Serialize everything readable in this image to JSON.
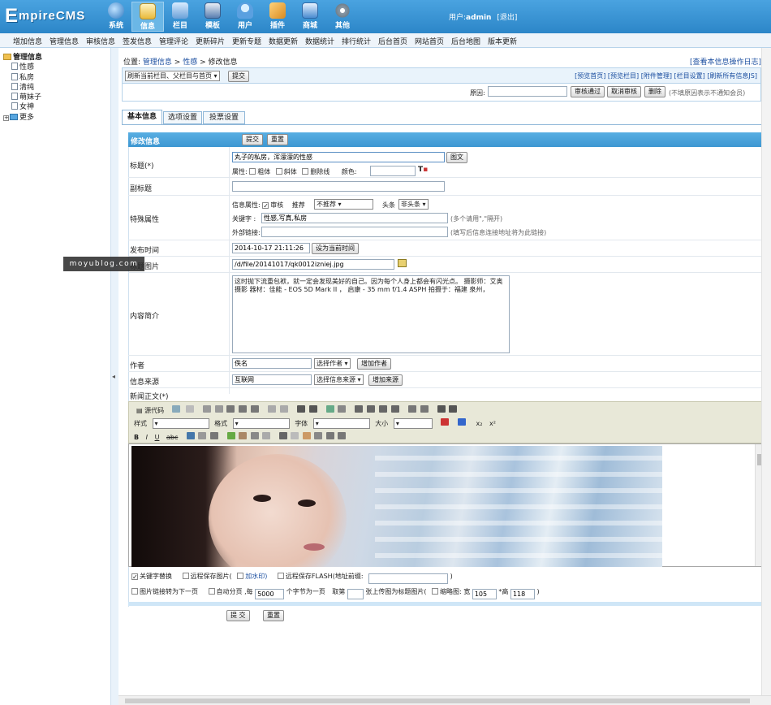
{
  "app": {
    "logo": "EmpireCMS"
  },
  "top_nav": [
    {
      "label": "系统",
      "icon": "globe-icon",
      "color": "#3a7fc0"
    },
    {
      "label": "信息",
      "icon": "edit-doc-icon",
      "color": "#f0c040"
    },
    {
      "label": "栏目",
      "icon": "folder-icon",
      "color": "#6aa0d8"
    },
    {
      "label": "模板",
      "icon": "template-icon",
      "color": "#5a7fb0"
    },
    {
      "label": "用户",
      "icon": "user-icon",
      "color": "#5aa0e0"
    },
    {
      "label": "插件",
      "icon": "plugin-icon",
      "color": "#e0a030"
    },
    {
      "label": "商城",
      "icon": "shop-icon",
      "color": "#4a8cd0"
    },
    {
      "label": "其他",
      "icon": "gear-icon",
      "color": "#8a9aa8"
    }
  ],
  "user": {
    "prefix": "用户:",
    "name": "admin",
    "logout": "[退出]"
  },
  "sub_nav": [
    "增加信息",
    "管理信息",
    "审核信息",
    "签发信息",
    "管理评论",
    "更新碎片",
    "更新专题",
    "数据更新",
    "数据统计",
    "排行统计",
    "后台首页",
    "网站首页",
    "后台地图",
    "版本更新"
  ],
  "tree": {
    "root": "管理信息",
    "items": [
      "性感",
      "私房",
      "清纯",
      "萌妹子",
      "女神"
    ],
    "more": "更多"
  },
  "breadcrumb": {
    "prefix": "位置:",
    "links": [
      "管理信息",
      "性感"
    ],
    "current": "修改信息",
    "log_link": "[查看本信息操作日志]"
  },
  "refresh": {
    "select": "刷新当前栏目、父栏目与首页",
    "submit": "提交",
    "links": [
      "[预览首页]",
      "[预览栏目]",
      "[附件管理]",
      "[栏目设置]",
      "[刷新所有信息JS]"
    ]
  },
  "audit": {
    "reason_label": "原因:",
    "pass": "审核通过",
    "cancel": "取消审核",
    "delete": "删除",
    "note": "(不填原因表示不通知会员)"
  },
  "tabs": [
    "基本信息",
    "选项设置",
    "投票设置"
  ],
  "form": {
    "header": "修改信息",
    "submit": "提交",
    "reset": "重置",
    "title_label": "标题(*)",
    "title_value": "丸子的私房，浑濛濛的性感",
    "title_img_btn": "图文",
    "attr_label": "属性:",
    "attrs": [
      "粗体",
      "斜体",
      "删除线"
    ],
    "color_label": "颜色:",
    "subtitle_label": "副标题",
    "special_label": "特殊属性",
    "info_attr_label": "信息属性:",
    "review": "审核",
    "recommend_label": "推荐",
    "recommend_value": "不推荐",
    "headline_label": "头条",
    "headline_value": "非头条",
    "keywords_label": "关键字 :",
    "keywords_value": "性感,写真,私房",
    "keywords_note": "(多个请用\",\"隔开)",
    "external_label": "外部链接:",
    "external_note": "(填写后信息连接地址将为此链接)",
    "pubtime_label": "发布时间",
    "pubtime_value": "2014-10-17 21:11:26",
    "pubtime_btn": "设为当前时间",
    "thumb_label": "标题图片",
    "thumb_value": "/d/file/20141017/qk0012izniej.jpg",
    "intro_label": "内容简介",
    "intro_value": "这时抛下流重包袱，就一定会发现美好的自己。因为每个人身上都会有闪光点。 摄影师：艾奥摄影 器材：佳能 - EOS 5D Mark II ， 启康 - 35 mm f/1.4 ASPH 拍摄于：福建 泉州，",
    "author_label": "作者",
    "author_value": "佚名",
    "author_select": "选择作者",
    "author_add": "增加作者",
    "source_label": "信息来源",
    "source_value": "互联网",
    "source_select": "选择信息来源",
    "source_add": "增加来源",
    "body_label": "新闻正文(*)"
  },
  "editor": {
    "source_btn": "源代码",
    "style_label": "样式",
    "format_label": "格式",
    "font_label": "字体",
    "size_label": "大小"
  },
  "watermark": "moyublog.com",
  "options": {
    "keyword_replace": "关键字替换",
    "remote_save_img": "远程保存图片(",
    "add_watermark": "加水印)",
    "remote_save_flash": "远程保存FLASH(地址前缀:",
    "close_paren": ")",
    "img_link_next": "图片链接转为下一页",
    "auto_page": "自动分页 ,每",
    "auto_page_value": "5000",
    "chars_per_page": "个字节为一页",
    "take": "取第",
    "take_suffix": "张上传图为标题图片(",
    "thumb": "缩略图: 宽",
    "thumb_w": "105",
    "thumb_h_label": "*高",
    "thumb_h": "118"
  },
  "footer": {
    "submit": "提 交",
    "reset": "重置"
  }
}
